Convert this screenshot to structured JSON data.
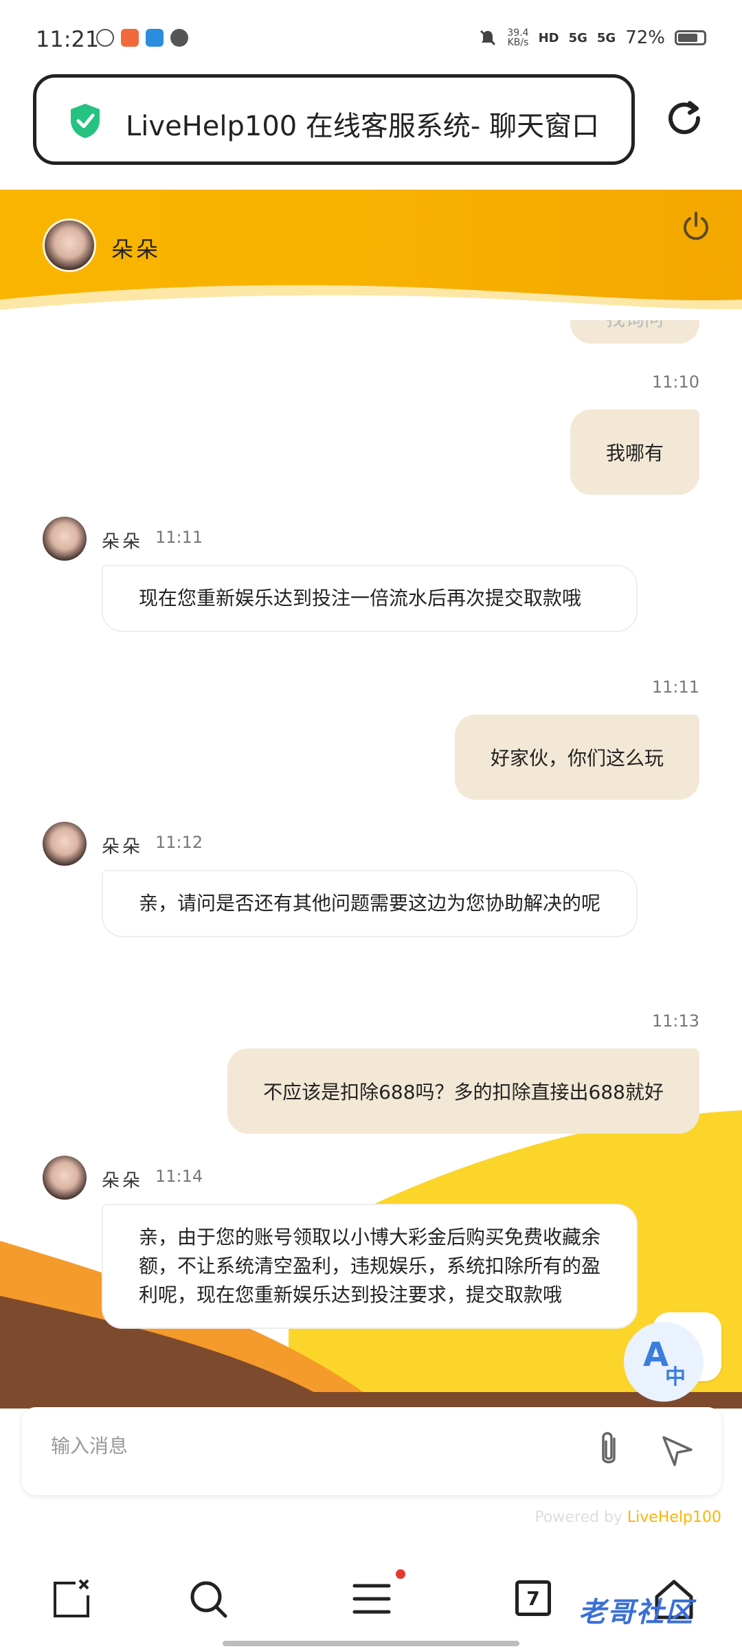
{
  "status_bar": {
    "time": "11:21",
    "net_speed_value": "39.4",
    "net_speed_unit": "KB/s",
    "hd": "HD",
    "sig1": "5G",
    "sig2": "5G",
    "battery": "72%"
  },
  "browser": {
    "page_title": "LiveHelp100 在线客服系统- 聊天窗口",
    "tab_count": "7"
  },
  "chat": {
    "agent_name": "朵朵",
    "partial_top_text": "找询问",
    "messages": [
      {
        "from": "me",
        "time": "11:10",
        "text": "我哪有"
      },
      {
        "from": "agent",
        "name": "朵朵",
        "time": "11:11",
        "text": "现在您重新娱乐达到投注一倍流水后再次提交取款哦"
      },
      {
        "from": "me",
        "time": "11:11",
        "text": "好家伙，你们这么玩"
      },
      {
        "from": "agent",
        "name": "朵朵",
        "time": "11:12",
        "text": "亲，请问是否还有其他问题需要这边为您协助解决的呢"
      },
      {
        "from": "me",
        "time": "11:13",
        "text": "不应该是扣除688吗？多的扣除直接出688就好"
      },
      {
        "from": "agent",
        "name": "朵朵",
        "time": "11:14",
        "text": "亲，由于您的账号领取以小博大彩金后购买免费收藏余额，不让系统清空盈利，违规娱乐，系统扣除所有的盈利呢，现在您重新娱乐达到投注要求，提交取款哦"
      }
    ],
    "input_placeholder": "输入消息",
    "powered_prefix": "Powered by ",
    "powered_brand": "LiveHelp100"
  },
  "watermark": "老哥社区",
  "icons": {
    "shield": "shield-check-icon",
    "reload": "reload-icon",
    "power": "power-icon",
    "attach": "paperclip-icon",
    "send": "send-icon",
    "translate": "translate-icon"
  },
  "colors": {
    "header": "#f9b500",
    "my_bubble": "#f2e8d5",
    "brand_accent": "#ffb300",
    "shield": "#26c281"
  }
}
